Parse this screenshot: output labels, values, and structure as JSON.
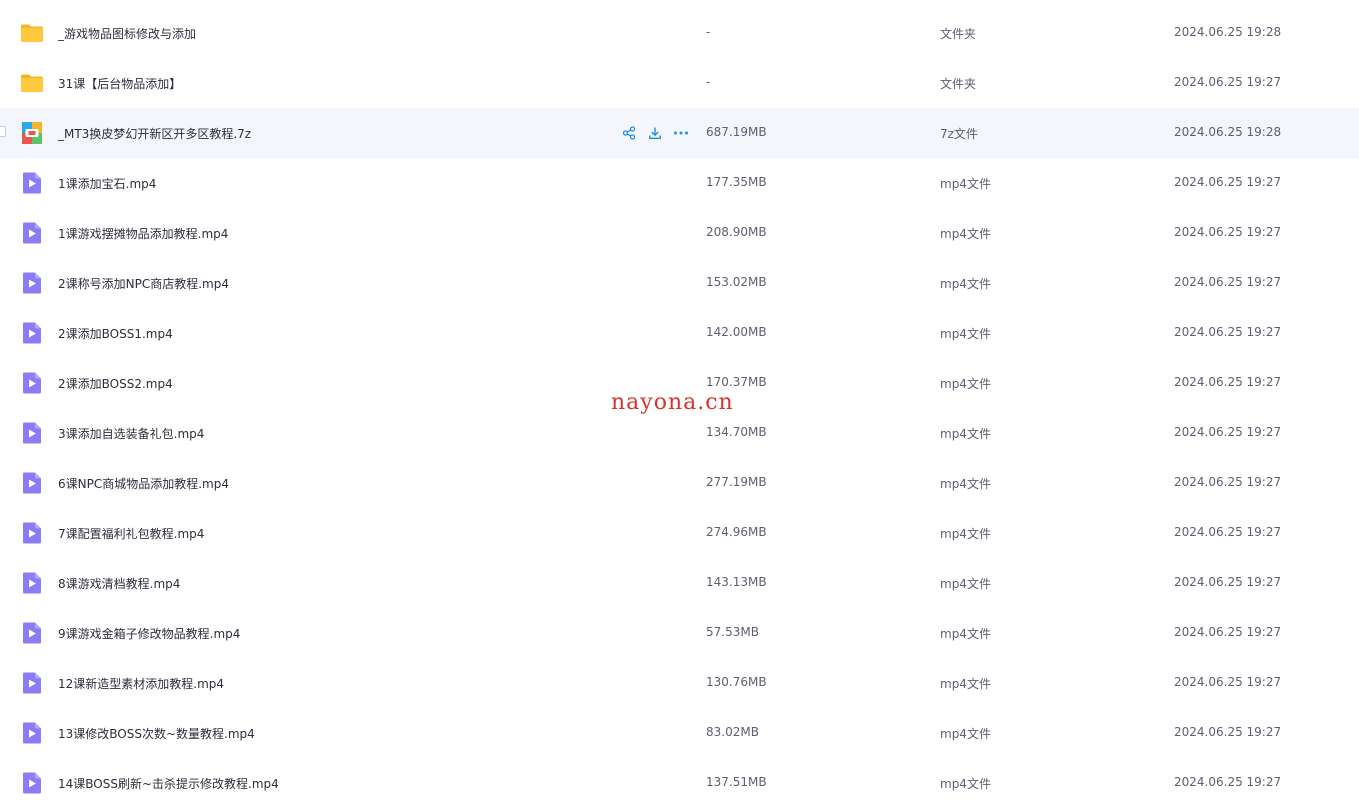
{
  "watermark": "nayona.cn",
  "files": [
    {
      "name": "_游戏物品图标修改与添加",
      "size": "-",
      "type": "文件夹",
      "date": "2024.06.25 19:28",
      "icon": "folder-icon"
    },
    {
      "name": "31课【后台物品添加】",
      "size": "-",
      "type": "文件夹",
      "date": "2024.06.25 19:27",
      "icon": "folder-icon"
    },
    {
      "name": "_MT3换皮梦幻开新区开多区教程.7z",
      "size": "687.19MB",
      "type": "7z文件",
      "date": "2024.06.25 19:28",
      "icon": "archive-icon",
      "hovered": true
    },
    {
      "name": "1课添加宝石.mp4",
      "size": "177.35MB",
      "type": "mp4文件",
      "date": "2024.06.25 19:27",
      "icon": "video-file-icon"
    },
    {
      "name": "1课游戏摆摊物品添加教程.mp4",
      "size": "208.90MB",
      "type": "mp4文件",
      "date": "2024.06.25 19:27",
      "icon": "video-file-icon"
    },
    {
      "name": "2课称号添加NPC商店教程.mp4",
      "size": "153.02MB",
      "type": "mp4文件",
      "date": "2024.06.25 19:27",
      "icon": "video-file-icon"
    },
    {
      "name": "2课添加BOSS1.mp4",
      "size": "142.00MB",
      "type": "mp4文件",
      "date": "2024.06.25 19:27",
      "icon": "video-file-icon"
    },
    {
      "name": "2课添加BOSS2.mp4",
      "size": "170.37MB",
      "type": "mp4文件",
      "date": "2024.06.25 19:27",
      "icon": "video-file-icon"
    },
    {
      "name": "3课添加自选装备礼包.mp4",
      "size": "134.70MB",
      "type": "mp4文件",
      "date": "2024.06.25 19:27",
      "icon": "video-file-icon"
    },
    {
      "name": "6课NPC商城物品添加教程.mp4",
      "size": "277.19MB",
      "type": "mp4文件",
      "date": "2024.06.25 19:27",
      "icon": "video-file-icon"
    },
    {
      "name": "7课配置福利礼包教程.mp4",
      "size": "274.96MB",
      "type": "mp4文件",
      "date": "2024.06.25 19:27",
      "icon": "video-file-icon"
    },
    {
      "name": "8课游戏清档教程.mp4",
      "size": "143.13MB",
      "type": "mp4文件",
      "date": "2024.06.25 19:27",
      "icon": "video-file-icon"
    },
    {
      "name": "9课游戏金箱子修改物品教程.mp4",
      "size": "57.53MB",
      "type": "mp4文件",
      "date": "2024.06.25 19:27",
      "icon": "video-file-icon"
    },
    {
      "name": "12课新造型素材添加教程.mp4",
      "size": "130.76MB",
      "type": "mp4文件",
      "date": "2024.06.25 19:27",
      "icon": "video-file-icon"
    },
    {
      "name": "13课修改BOSS次数~数量教程.mp4",
      "size": "83.02MB",
      "type": "mp4文件",
      "date": "2024.06.25 19:27",
      "icon": "video-file-icon"
    },
    {
      "name": "14课BOSS刷新~击杀提示修改教程.mp4",
      "size": "137.51MB",
      "type": "mp4文件",
      "date": "2024.06.25 19:27",
      "icon": "video-file-icon"
    }
  ],
  "row_actions": [
    "share-icon",
    "download-icon",
    "more-icon"
  ],
  "colors": {
    "folder": "#ffc83d",
    "video": "#8b7cf6",
    "accent": "#1e90e6",
    "hover_row": "#f4f6fb",
    "watermark": "#d9342b"
  }
}
